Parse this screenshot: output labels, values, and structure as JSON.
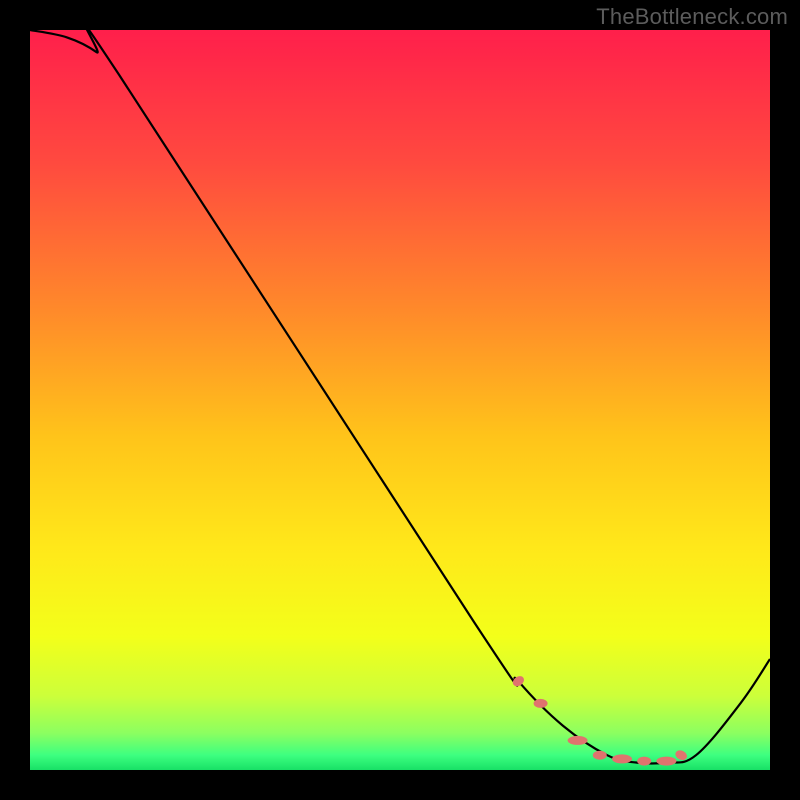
{
  "watermark": "TheBottleneck.com",
  "chart_data": {
    "type": "line",
    "title": "",
    "xlabel": "",
    "ylabel": "",
    "xlim": [
      0,
      100
    ],
    "ylim": [
      0,
      100
    ],
    "grid": false,
    "series": [
      {
        "name": "bottleneck-curve",
        "x": [
          0,
          5,
          9,
          12,
          60,
          66,
          72,
          78,
          82,
          86,
          90,
          96,
          100
        ],
        "y": [
          100,
          99,
          97,
          94,
          20,
          12,
          6,
          2,
          1,
          1,
          2,
          9,
          15
        ]
      }
    ],
    "markers": {
      "name": "optimal-band",
      "x": [
        66,
        69,
        74,
        77,
        80,
        83,
        86,
        88
      ],
      "y": [
        12,
        9,
        4,
        2,
        1.5,
        1.2,
        1.2,
        2
      ]
    },
    "gradient_stops": [
      {
        "offset": 0.0,
        "color": "#ff1f4b"
      },
      {
        "offset": 0.18,
        "color": "#ff4a3f"
      },
      {
        "offset": 0.38,
        "color": "#ff8a2a"
      },
      {
        "offset": 0.55,
        "color": "#ffc41a"
      },
      {
        "offset": 0.7,
        "color": "#ffe81a"
      },
      {
        "offset": 0.82,
        "color": "#f3ff1a"
      },
      {
        "offset": 0.9,
        "color": "#ccff3a"
      },
      {
        "offset": 0.95,
        "color": "#8cff60"
      },
      {
        "offset": 0.98,
        "color": "#3dff80"
      },
      {
        "offset": 1.0,
        "color": "#18e066"
      }
    ],
    "curve_stroke": "#000000",
    "marker_color": "#e0736e"
  }
}
